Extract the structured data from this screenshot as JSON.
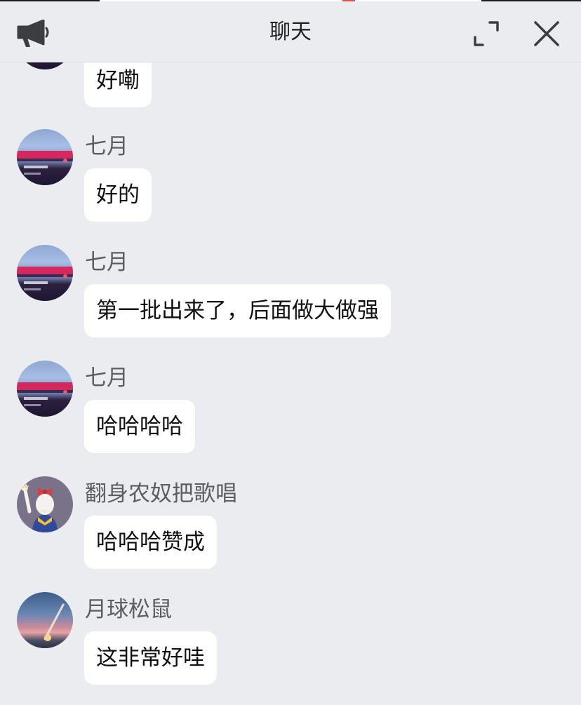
{
  "header": {
    "title": "聊天",
    "icons": [
      "megaphone-icon",
      "expand-icon",
      "close-icon"
    ]
  },
  "messages": [
    {
      "sender": "",
      "text": "好嘞",
      "avatar": "stadium-avatar"
    },
    {
      "sender": "七月",
      "text": "好的",
      "avatar": "stadium-avatar"
    },
    {
      "sender": "七月",
      "text": "第一批出来了，后面做大做强",
      "avatar": "stadium-avatar"
    },
    {
      "sender": "七月",
      "text": "哈哈哈哈",
      "avatar": "stadium-avatar"
    },
    {
      "sender": "翻身农奴把歌唱",
      "text": "哈哈哈赞成",
      "avatar": "cartoon-duck-avatar"
    },
    {
      "sender": "月球松鼠",
      "text": "这非常好哇",
      "avatar": "rocket-launch-avatar"
    }
  ],
  "colors": {
    "background": "#ebecf0",
    "bubble": "#ffffff",
    "sender_text": "#5b5d63",
    "message_text": "#111111"
  }
}
